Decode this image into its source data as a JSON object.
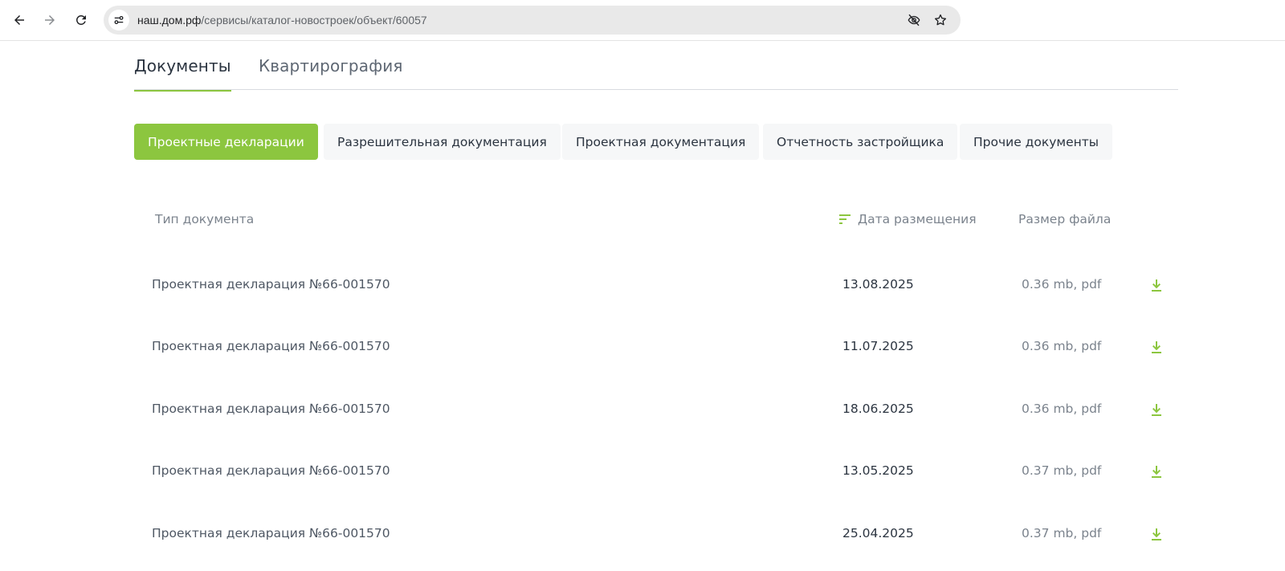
{
  "browser": {
    "url_host": "наш.дом.рф",
    "url_path": "/сервисы/каталог-новостроек/объект/60057"
  },
  "tabs": [
    {
      "label": "Документы",
      "active": true
    },
    {
      "label": "Квартирография",
      "active": false
    }
  ],
  "filters": [
    {
      "label": "Проектные декларации",
      "active": true
    },
    {
      "label": "Разрешительная документация",
      "active": false
    },
    {
      "label": "Проектная документация",
      "active": false
    },
    {
      "label": "Отчетность застройщика",
      "active": false
    },
    {
      "label": "Прочие документы",
      "active": false
    }
  ],
  "table": {
    "headers": {
      "type": "Тип документа",
      "date": "Дата размещения",
      "size": "Размер файла"
    },
    "rows": [
      {
        "name": "Проектная декларация №66-001570",
        "date": "13.08.2025",
        "size": "0.36 mb, pdf"
      },
      {
        "name": "Проектная декларация №66-001570",
        "date": "11.07.2025",
        "size": "0.36 mb, pdf"
      },
      {
        "name": "Проектная декларация №66-001570",
        "date": "18.06.2025",
        "size": "0.36 mb, pdf"
      },
      {
        "name": "Проектная декларация №66-001570",
        "date": "13.05.2025",
        "size": "0.37 mb, pdf"
      },
      {
        "name": "Проектная декларация №66-001570",
        "date": "25.04.2025",
        "size": "0.37 mb, pdf"
      }
    ]
  },
  "colors": {
    "accent": "#8cc63f",
    "text": "#2b3440",
    "muted": "#7b838d"
  },
  "icons": {
    "back": "arrow-left-icon",
    "forward": "arrow-right-icon",
    "reload": "reload-icon",
    "site_info": "tune-icon",
    "eye_off": "eye-off-icon",
    "bookmark": "star-icon",
    "sort": "sort-icon",
    "download": "download-icon"
  }
}
